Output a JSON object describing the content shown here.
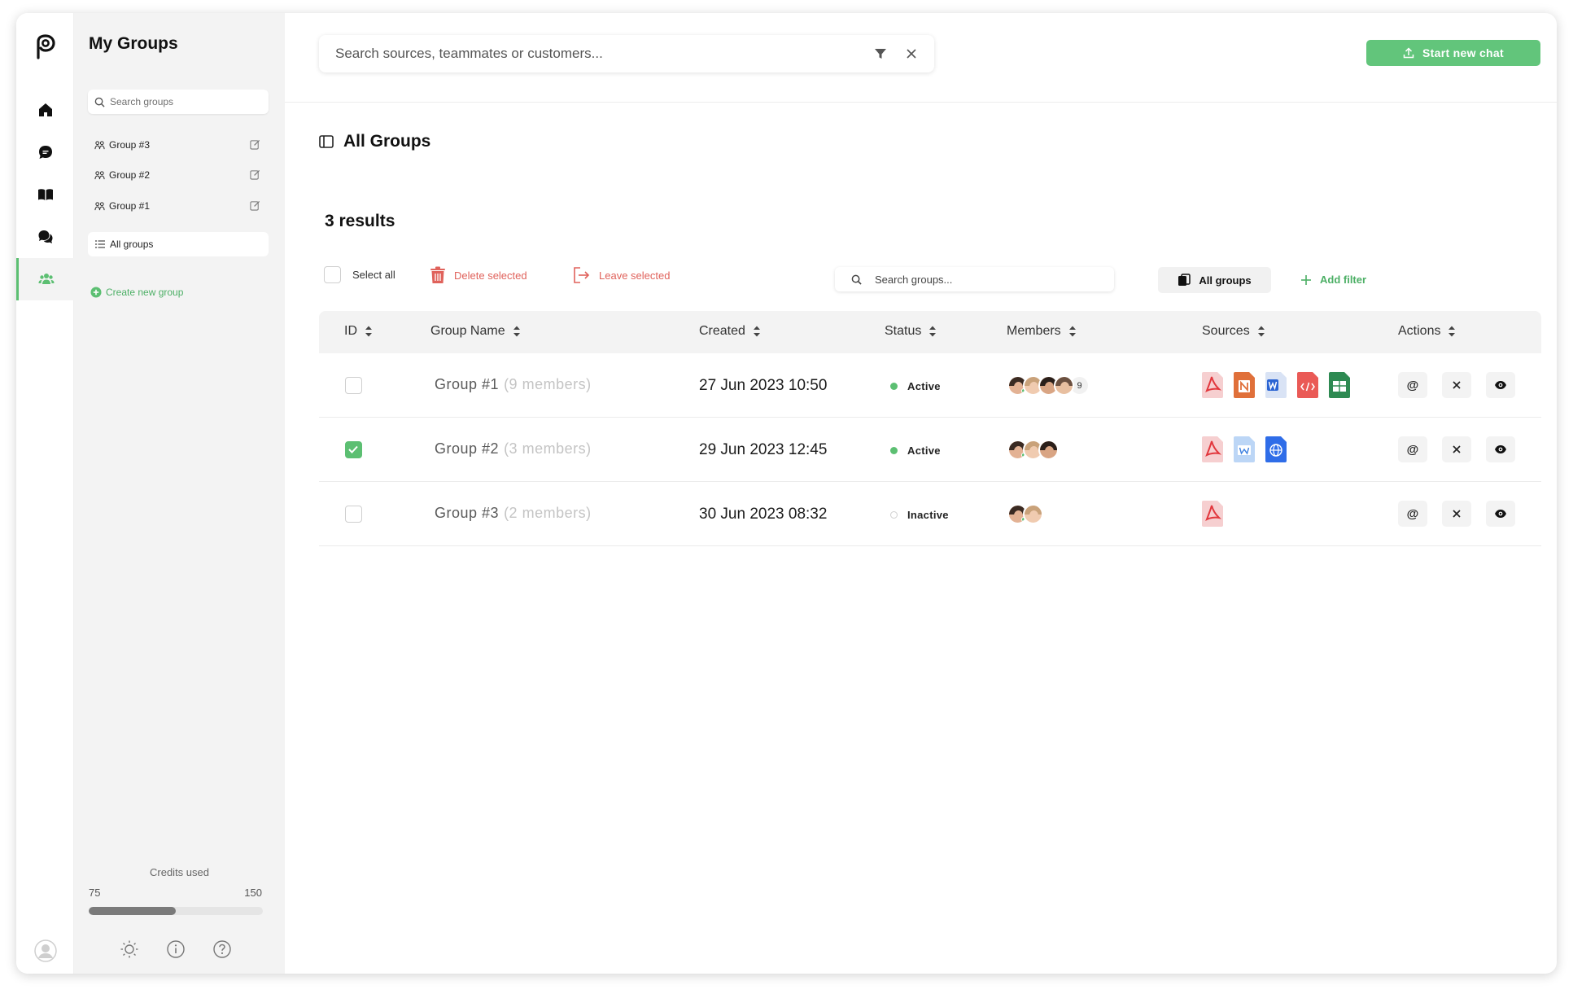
{
  "sidebar": {
    "title": "My Groups",
    "search_placeholder": "Search groups",
    "groups": [
      {
        "label": "Group #3"
      },
      {
        "label": "Group #2"
      },
      {
        "label": "Group #1"
      }
    ],
    "all_groups_label": "All groups",
    "create_label": "Create new group",
    "credits": {
      "label": "Credits used",
      "min": "75",
      "max": "150",
      "used_fraction": 0.5
    }
  },
  "topbar": {
    "search_placeholder": "Search sources, teammates or customers...",
    "start_chat_label": "Start new chat"
  },
  "page": {
    "title": "All Groups",
    "results": "3 results"
  },
  "toolbar": {
    "select_all": "Select all",
    "delete_selected": "Delete selected",
    "leave_selected": "Leave selected",
    "search_placeholder": "Search groups...",
    "all_groups": "All groups",
    "add_filter": "Add filter"
  },
  "table": {
    "columns": [
      "ID",
      "Group Name",
      "Created",
      "Status",
      "Members",
      "Sources",
      "Actions"
    ],
    "rows": [
      {
        "name": "Group #1",
        "members_text": "(9 members)",
        "created": "27 Jun 2023 10:50",
        "status": "Active",
        "active": true,
        "checked": false,
        "avatars": 4,
        "more": "9",
        "sources": [
          "pdf-icon",
          "notion-icon",
          "word-icon",
          "html-icon",
          "sheets-icon"
        ]
      },
      {
        "name": "Group #2",
        "members_text": "(3 members)",
        "created": "29 Jun 2023 12:45",
        "status": "Active",
        "active": true,
        "checked": true,
        "avatars": 3,
        "more": "",
        "sources": [
          "pdf-icon",
          "gdoc-icon",
          "web-icon"
        ]
      },
      {
        "name": "Group #3",
        "members_text": "(2 members)",
        "created": "30 Jun 2023 08:32",
        "status": "Inactive",
        "active": false,
        "checked": false,
        "avatars": 2,
        "more": "",
        "sources": [
          "pdf-icon"
        ]
      }
    ],
    "action_mention": "@"
  },
  "colors": {
    "accent": "#5cbf72",
    "danger": "#e0625b"
  }
}
